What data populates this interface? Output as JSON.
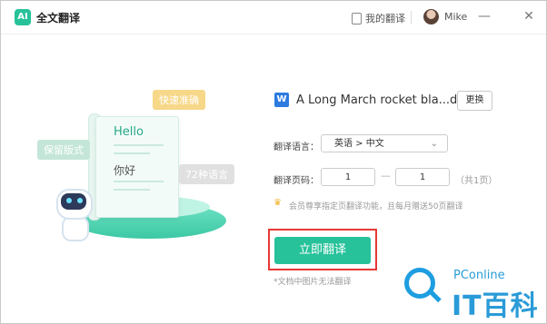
{
  "app": {
    "logo_text": "AI",
    "title": "全文翻译",
    "accent": "#27c29a"
  },
  "header": {
    "my_translations": "我的翻译",
    "user": "Mike",
    "minimize": "—",
    "close": "✕"
  },
  "illustration": {
    "bubble_quick": "快速准确",
    "bubble_layout": "保留版式",
    "bubble_langs": "72种语言",
    "hello": "Hello",
    "nihao": "你好"
  },
  "file": {
    "icon_letter": "W",
    "name": "A Long March rocket bla...docx",
    "change_button": "更换"
  },
  "form": {
    "language_label": "翻译语言：",
    "language_value": "英语 > 中文",
    "pages_label": "翻译页码：",
    "page_from": "1",
    "page_to": "1",
    "dash": "—",
    "total": "（共1页）"
  },
  "vip_notice": "会员尊享指定页翻译功能，且每月赠送50页翻译",
  "translate_button": "立即翻译",
  "note": "*文档中图片无法翻译",
  "watermark": {
    "small": "PConline",
    "big": "IT百科"
  }
}
